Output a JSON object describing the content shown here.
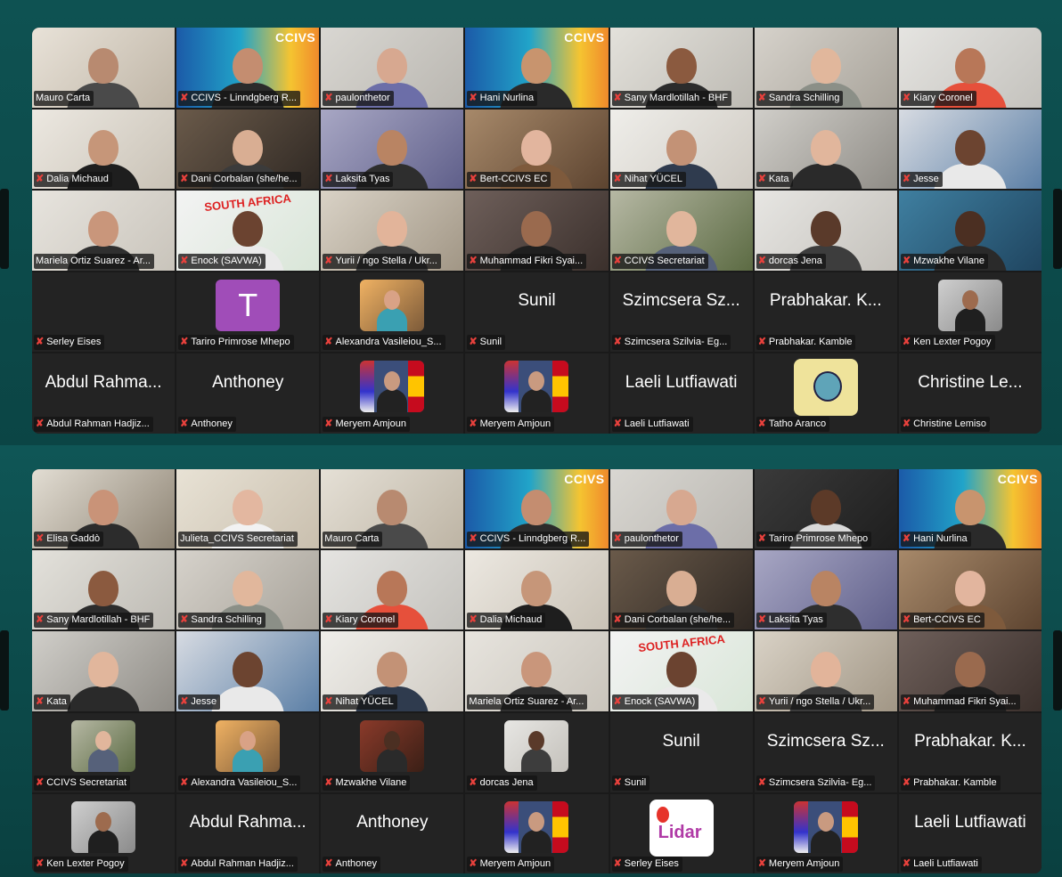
{
  "panels": [
    {
      "id": "top",
      "tiles": [
        {
          "name": "Mauro Carta",
          "muted": false,
          "bg": "linear-gradient(135deg,#e8e2d8,#bfb5a6)",
          "skin": "#b88a70",
          "shirt": "#4a4a4a"
        },
        {
          "name": "CCIVS - Linndgberg R...",
          "muted": true,
          "bg": "linear-gradient(90deg,#1b5aa8,#21a4c9 45%,#f5c431 80%,#f08a2b)",
          "skin": "#c48d70",
          "shirt": "#2b2b2b",
          "badge": "CCIVS"
        },
        {
          "name": "paulonthetor",
          "muted": true,
          "bg": "linear-gradient(135deg,#d9d7d2,#b9b6b0)",
          "skin": "#d7a890",
          "shirt": "#6c6ea8"
        },
        {
          "name": "Hani Nurlina",
          "muted": true,
          "bg": "linear-gradient(90deg,#1b5aa8,#21a4c9 45%,#f5c431 80%,#f08a2b)",
          "skin": "#c8946e",
          "shirt": "#2a2a2a",
          "badge": "CCIVS"
        },
        {
          "name": "Sany Mardlotillah - BHF",
          "muted": true,
          "bg": "linear-gradient(135deg,#e3e1db,#bdbab3)",
          "skin": "#8b5a3f",
          "shirt": "#2c2c2c"
        },
        {
          "name": "Sandra Schilling",
          "muted": true,
          "bg": "linear-gradient(135deg,#d6d2cb,#a8a39a)",
          "skin": "#e1b79c",
          "shirt": "#8b8f87"
        },
        {
          "name": "Kiary Coronel",
          "muted": true,
          "bg": "linear-gradient(135deg,#e5e4e1,#c4c2bd)",
          "skin": "#b87758",
          "shirt": "#e6503b"
        },
        {
          "name": "Dalia Michaud",
          "muted": true,
          "bg": "linear-gradient(135deg,#ece8e1,#c9c2b6)",
          "skin": "#c69679",
          "shirt": "#1e1e1e"
        },
        {
          "name": "Dani Corbalan (she/he...",
          "muted": true,
          "bg": "linear-gradient(135deg,#6a5a4a,#2f2823)",
          "skin": "#d9ae93",
          "shirt": "#3b3b3b"
        },
        {
          "name": "Laksita Tyas",
          "muted": true,
          "bg": "linear-gradient(135deg,#a8a7c4,#5f5f8a)",
          "skin": "#b98463",
          "shirt": "#2e2e2e"
        },
        {
          "name": "Bert-CCIVS EC",
          "muted": true,
          "bg": "linear-gradient(135deg,#a7896a,#5d4430)",
          "skin": "#e2b59e",
          "shirt": "#7e5a3c"
        },
        {
          "name": "Nihat YÜCEL",
          "muted": true,
          "bg": "linear-gradient(135deg,#efeeea,#cfcac2)",
          "skin": "#c39276",
          "shirt": "#2f3b4e"
        },
        {
          "name": "Kata",
          "muted": true,
          "bg": "linear-gradient(135deg,#d0cec9,#8f8c86)",
          "skin": "#e1b69c",
          "shirt": "#2a2a2a"
        },
        {
          "name": "Jesse",
          "muted": true,
          "bg": "linear-gradient(135deg,#d7dbe2,#5b7fa6)",
          "skin": "#6c4430",
          "shirt": "#e9e9e9"
        },
        {
          "name": "Mariela Ortiz Suarez - Ar...",
          "muted": false,
          "bg": "linear-gradient(135deg,#e7e4de,#c9c4bb)",
          "skin": "#c9967b",
          "shirt": "#2f2f2f"
        },
        {
          "name": "Enock (SAVWA)",
          "muted": true,
          "bg": "linear-gradient(135deg,#f3f3f3,#d9e6d8)",
          "skin": "#6b4330",
          "shirt": "#eaeaea",
          "banner": "SOUTH AFRICA"
        },
        {
          "name": "Yurii / ngo Stella / Ukr...",
          "muted": true,
          "bg": "linear-gradient(135deg,#d9d2c6,#a19685)",
          "skin": "#e2b49a",
          "shirt": "#3b3b3b"
        },
        {
          "name": "Muhammad Fikri Syai...",
          "muted": true,
          "bg": "linear-gradient(135deg,#6e5f5a,#3b302c)",
          "skin": "#9a6a4e",
          "shirt": "#1f1f1f"
        },
        {
          "name": "CCIVS Secretariat",
          "muted": true,
          "bg": "linear-gradient(135deg,#b6b8a4,#5c6b43)",
          "skin": "#e1b69c",
          "shirt": "#56617a"
        },
        {
          "name": "dorcas Jena",
          "muted": true,
          "bg": "linear-gradient(135deg,#e7e6e3,#c4c1bb)",
          "skin": "#5a3a2a",
          "shirt": "#3d3d3d"
        },
        {
          "name": "Mzwakhe Vilane",
          "muted": true,
          "bg": "linear-gradient(135deg,#3f7fa0,#1f4560)",
          "skin": "#4b2f22",
          "shirt": "#2a2a2a"
        },
        {
          "name": "Serley Eises",
          "muted": true,
          "type": "blank"
        },
        {
          "name": "Tariro Primrose Mhepo",
          "muted": true,
          "type": "avatar",
          "letter": "T"
        },
        {
          "name": "Alexandra Vasileiou_S...",
          "muted": true,
          "type": "photo",
          "bg": "linear-gradient(135deg,#f0b263,#7c5a39)",
          "skin": "#d9a286",
          "shirt": "#3aa0b2"
        },
        {
          "name": "Sunil",
          "muted": true,
          "type": "text",
          "big": "Sunil"
        },
        {
          "name": "Szimcsera Szilvia- Eg...",
          "muted": true,
          "type": "text",
          "big": "Szimcsera Sz..."
        },
        {
          "name": "Prabhakar. Kamble",
          "muted": true,
          "type": "text",
          "big": "Prabhakar. K..."
        },
        {
          "name": "Ken Lexter Pogoy",
          "muted": true,
          "type": "photo",
          "bg": "linear-gradient(135deg,#cfcfcf,#8a8a8a)",
          "skin": "#9d6b4e",
          "shirt": "#1f1f1f"
        },
        {
          "name": "Abdul Rahman Hadjiz...",
          "muted": true,
          "type": "text",
          "big": "Abdul Rahma..."
        },
        {
          "name": "Anthoney",
          "muted": true,
          "type": "text",
          "big": "Anthoney"
        },
        {
          "name": "Meryem Amjoun",
          "muted": true,
          "type": "flags"
        },
        {
          "name": "Meryem Amjoun",
          "muted": true,
          "type": "flags"
        },
        {
          "name": "Laeli Lutfiawati",
          "muted": true,
          "type": "text",
          "big": "Laeli Lutfiawati"
        },
        {
          "name": "Tatho Aranco",
          "muted": true,
          "type": "ape"
        },
        {
          "name": "Christine Lemiso",
          "muted": true,
          "type": "text",
          "big": "Christine Le..."
        }
      ]
    },
    {
      "id": "bottom",
      "tiles": [
        {
          "name": "Elisa Gaddò",
          "muted": true,
          "bg": "linear-gradient(135deg,#e2ddd3,#8e8474)",
          "skin": "#c99378",
          "shirt": "#2c2c2c"
        },
        {
          "name": "Julieta_CCIVS Secretariat",
          "muted": false,
          "active": true,
          "bg": "linear-gradient(135deg,#e8e2d5,#c9bfae)",
          "skin": "#e3b7a0",
          "shirt": "#f2f2f2"
        },
        {
          "name": "Mauro Carta",
          "muted": false,
          "bg": "linear-gradient(135deg,#e5e0d6,#bdb4a4)",
          "skin": "#b88a70",
          "shirt": "#4a4a4a"
        },
        {
          "name": "CCIVS - Linndgberg R...",
          "muted": true,
          "bg": "linear-gradient(90deg,#1b5aa8,#21a4c9 45%,#f5c431 80%,#f08a2b)",
          "skin": "#c48d70",
          "shirt": "#2b2b2b",
          "badge": "CCIVS"
        },
        {
          "name": "paulonthetor",
          "muted": true,
          "bg": "linear-gradient(135deg,#d9d7d2,#b9b6b0)",
          "skin": "#d7a890",
          "shirt": "#6c6ea8"
        },
        {
          "name": "Tariro Primrose Mhepo",
          "muted": true,
          "bg": "linear-gradient(135deg,#3a3a3a,#1e1e1e)",
          "skin": "#5c3a28",
          "shirt": "#d9d9d9"
        },
        {
          "name": "Hani Nurlina",
          "muted": true,
          "bg": "linear-gradient(90deg,#1b5aa8,#21a4c9 45%,#f5c431 80%,#f08a2b)",
          "skin": "#c8946e",
          "shirt": "#2a2a2a",
          "badge": "CCIVS"
        },
        {
          "name": "Sany Mardlotillah - BHF",
          "muted": true,
          "bg": "linear-gradient(135deg,#e3e1db,#bdbab3)",
          "skin": "#8b5a3f",
          "shirt": "#2c2c2c"
        },
        {
          "name": "Sandra Schilling",
          "muted": true,
          "bg": "linear-gradient(135deg,#d6d2cb,#a8a39a)",
          "skin": "#e1b79c",
          "shirt": "#8b8f87"
        },
        {
          "name": "Kiary Coronel",
          "muted": true,
          "bg": "linear-gradient(135deg,#e5e4e1,#c4c2bd)",
          "skin": "#b87758",
          "shirt": "#e6503b"
        },
        {
          "name": "Dalia Michaud",
          "muted": true,
          "bg": "linear-gradient(135deg,#ece8e1,#c9c2b6)",
          "skin": "#c69679",
          "shirt": "#1e1e1e"
        },
        {
          "name": "Dani Corbalan (she/he...",
          "muted": true,
          "bg": "linear-gradient(135deg,#6a5a4a,#2f2823)",
          "skin": "#d9ae93",
          "shirt": "#3b3b3b"
        },
        {
          "name": "Laksita Tyas",
          "muted": true,
          "bg": "linear-gradient(135deg,#a8a7c4,#5f5f8a)",
          "skin": "#b98463",
          "shirt": "#2e2e2e"
        },
        {
          "name": "Bert-CCIVS EC",
          "muted": true,
          "bg": "linear-gradient(135deg,#a7896a,#5d4430)",
          "skin": "#e2b59e",
          "shirt": "#7e5a3c"
        },
        {
          "name": "Kata",
          "muted": true,
          "bg": "linear-gradient(135deg,#d0cec9,#8f8c86)",
          "skin": "#e1b69c",
          "shirt": "#2a2a2a"
        },
        {
          "name": "Jesse",
          "muted": true,
          "bg": "linear-gradient(135deg,#d7dbe2,#5b7fa6)",
          "skin": "#6c4430",
          "shirt": "#e9e9e9"
        },
        {
          "name": "Nihat YÜCEL",
          "muted": true,
          "bg": "linear-gradient(135deg,#efeeea,#cfcac2)",
          "skin": "#c39276",
          "shirt": "#2f3b4e"
        },
        {
          "name": "Mariela Ortiz Suarez - Ar...",
          "muted": false,
          "bg": "linear-gradient(135deg,#e7e4de,#c9c4bb)",
          "skin": "#c9967b",
          "shirt": "#2f2f2f"
        },
        {
          "name": "Enock (SAVWA)",
          "muted": true,
          "bg": "linear-gradient(135deg,#f3f3f3,#d9e6d8)",
          "skin": "#6b4330",
          "shirt": "#eaeaea",
          "banner": "SOUTH AFRICA"
        },
        {
          "name": "Yurii / ngo Stella / Ukr...",
          "muted": true,
          "bg": "linear-gradient(135deg,#d9d2c6,#a19685)",
          "skin": "#e2b49a",
          "shirt": "#3b3b3b"
        },
        {
          "name": "Muhammad Fikri Syai...",
          "muted": true,
          "bg": "linear-gradient(135deg,#6e5f5a,#3b302c)",
          "skin": "#9a6a4e",
          "shirt": "#1f1f1f"
        },
        {
          "name": "CCIVS Secretariat",
          "muted": true,
          "type": "photo",
          "bg": "linear-gradient(135deg,#b6b8a4,#5c6b43)",
          "skin": "#e1b69c",
          "shirt": "#56617a"
        },
        {
          "name": "Alexandra Vasileiou_S...",
          "muted": true,
          "type": "photo",
          "bg": "linear-gradient(135deg,#f0b263,#7c5a39)",
          "skin": "#d9a286",
          "shirt": "#3aa0b2"
        },
        {
          "name": "Mzwakhe Vilane",
          "muted": true,
          "type": "photo",
          "bg": "linear-gradient(135deg,#8a3a2a,#3a1f16)",
          "skin": "#4b2f22",
          "shirt": "#2a2a2a"
        },
        {
          "name": "dorcas Jena",
          "muted": true,
          "type": "photo",
          "bg": "linear-gradient(135deg,#e7e6e3,#c4c1bb)",
          "skin": "#5a3a2a",
          "shirt": "#3d3d3d"
        },
        {
          "name": "Sunil",
          "muted": true,
          "type": "text",
          "big": "Sunil"
        },
        {
          "name": "Szimcsera Szilvia- Eg...",
          "muted": true,
          "type": "text",
          "big": "Szimcsera Sz..."
        },
        {
          "name": "Prabhakar. Kamble",
          "muted": true,
          "type": "text",
          "big": "Prabhakar. K..."
        },
        {
          "name": "Ken Lexter Pogoy",
          "muted": true,
          "type": "photo",
          "bg": "linear-gradient(135deg,#cfcfcf,#8a8a8a)",
          "skin": "#9d6b4e",
          "shirt": "#1f1f1f"
        },
        {
          "name": "Abdul Rahman Hadjiz...",
          "muted": true,
          "type": "text",
          "big": "Abdul Rahma..."
        },
        {
          "name": "Anthoney",
          "muted": true,
          "type": "text",
          "big": "Anthoney"
        },
        {
          "name": "Meryem Amjoun",
          "muted": true,
          "type": "flags"
        },
        {
          "name": "Serley Eises",
          "muted": true,
          "type": "lidar",
          "logo": "Lidar"
        },
        {
          "name": "Meryem Amjoun",
          "muted": true,
          "type": "flags"
        },
        {
          "name": "Laeli Lutfiawati",
          "muted": true,
          "type": "text",
          "big": "Laeli Lutfiawati"
        }
      ]
    }
  ]
}
